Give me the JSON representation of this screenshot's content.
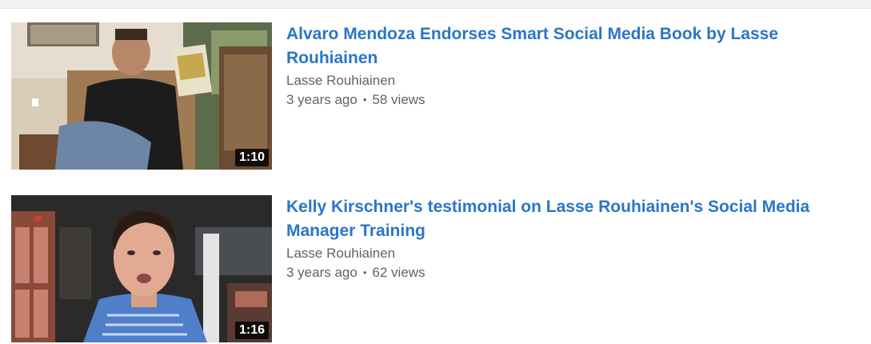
{
  "videos": [
    {
      "title": "Alvaro Mendoza Endorses Smart Social Media Book by Lasse Rouhiainen",
      "channel": "Lasse Rouhiainen",
      "age": "3 years ago",
      "views": "58 views",
      "duration": "1:10"
    },
    {
      "title": "Kelly Kirschner's testimonial on Lasse Rouhiainen's Social Media Manager Training",
      "channel": "Lasse Rouhiainen",
      "age": "3 years ago",
      "views": "62 views",
      "duration": "1:16"
    }
  ],
  "separator": "•"
}
